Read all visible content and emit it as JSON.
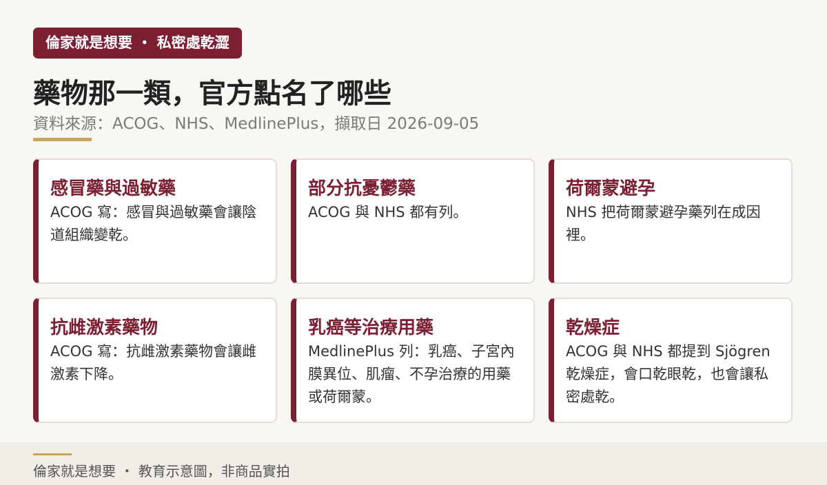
{
  "header": {
    "brand_badge": "倫家就是想要 ・ 私密處乾澀",
    "title": "藥物那一類，官方點名了哪些",
    "source": "資料來源：ACOG、NHS、MedlinePlus，擷取日 2026-09-05"
  },
  "cards": [
    {
      "title": "感冒藥與過敏藥",
      "body": "ACOG 寫：感冒與過敏藥會讓陰道組織變乾。"
    },
    {
      "title": "部分抗憂鬱藥",
      "body": "ACOG 與 NHS 都有列。"
    },
    {
      "title": "荷爾蒙避孕",
      "body": "NHS 把荷爾蒙避孕藥列在成因裡。"
    },
    {
      "title": "抗雌激素藥物",
      "body": "ACOG 寫：抗雌激素藥物會讓雌激素下降。"
    },
    {
      "title": "乳癌等治療用藥",
      "body": "MedlinePlus 列：乳癌、子宮內膜異位、肌瘤、不孕治療的用藥或荷爾蒙。"
    },
    {
      "title": "乾燥症",
      "body": "ACOG 與 NHS 都提到 Sjögren 乾燥症，會口乾眼乾，也會讓私密處乾。"
    }
  ],
  "footer": {
    "text": "倫家就是想要 ・ 教育示意圖，非商品實拍"
  },
  "colors": {
    "accent": "#7b1f33",
    "gold": "#c9a45c",
    "background": "#f9f7f3"
  }
}
